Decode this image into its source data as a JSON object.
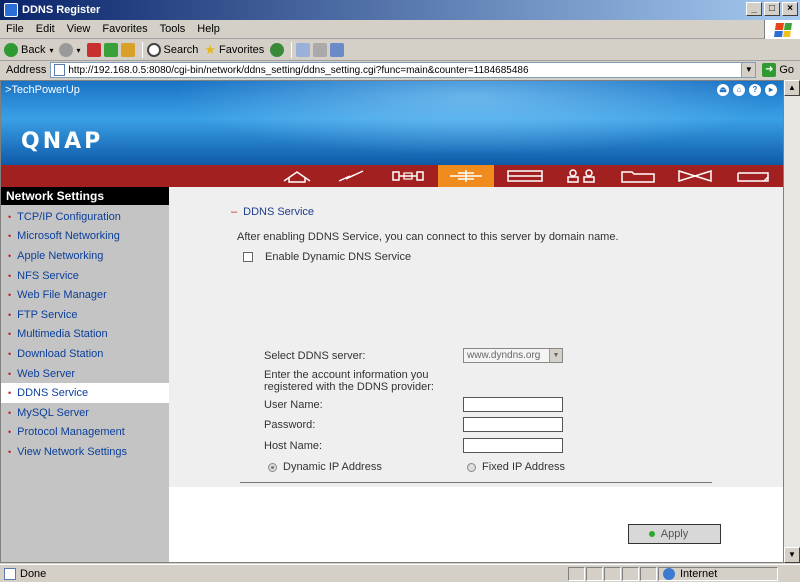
{
  "window": {
    "title": "DDNS Register"
  },
  "menu": [
    "File",
    "Edit",
    "View",
    "Favorites",
    "Tools",
    "Help"
  ],
  "toolbar": {
    "back": "Back",
    "search": "Search",
    "favorites": "Favorites"
  },
  "address": {
    "label": "Address",
    "url": "http://192.168.0.5:8080/cgi-bin/network/ddns_setting/ddns_setting.cgi?func=main&counter=1184685486",
    "go": "Go"
  },
  "header": {
    "crumb": ">TechPowerUp",
    "logo": "QNAP"
  },
  "sidebar": {
    "title": "Network Settings",
    "items": [
      "TCP/IP Configuration",
      "Microsoft Networking",
      "Apple Networking",
      "NFS Service",
      "Web File Manager",
      "FTP Service",
      "Multimedia Station",
      "Download Station",
      "Web Server",
      "DDNS Service",
      "MySQL Server",
      "Protocol Management",
      "View Network Settings"
    ],
    "active_index": 9
  },
  "form": {
    "section_title": "DDNS Service",
    "description": "After enabling DDNS Service, you can connect to this server by domain name.",
    "enable_label": "Enable Dynamic DNS Service",
    "select_server_label": "Select DDNS server:",
    "select_server_value": "www.dyndns.org",
    "account_info_line1": "Enter the account information you",
    "account_info_line2": "registered with the DDNS provider:",
    "username_label": "User Name:",
    "password_label": "Password:",
    "hostname_label": "Host Name:",
    "dynamic_ip_label": "Dynamic IP Address",
    "fixed_ip_label": "Fixed IP Address",
    "apply_label": "Apply"
  },
  "status": {
    "text": "Done",
    "zone": "Internet"
  },
  "colors": {
    "nav_red": "#a32020",
    "nav_active": "#f08c1e",
    "link_blue": "#0b3f9a"
  }
}
